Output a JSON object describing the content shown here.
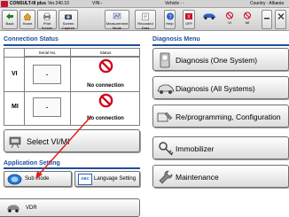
{
  "titlebar": {
    "app_name": "CONSULT-III plus",
    "version": "Ver.240.10",
    "vin": "VIN:-",
    "vehicle": "Vehicle : -",
    "country": "Country : Albania"
  },
  "toolbar": {
    "back": "Back",
    "home": "Home",
    "print_screen": "Print Screen",
    "screen_capture": "Screen Capture",
    "measurement_mode": "Measurement Mode",
    "recorded_data": "Recorded Data",
    "help": "Help",
    "off": "OFF",
    "vi": "VI",
    "mi": "MI"
  },
  "connection_status": {
    "heading": "Connection Status",
    "col_serial": "Serial No.",
    "col_status": "Status",
    "rows": [
      {
        "label": "VI",
        "serial": "-",
        "status": "No connection"
      },
      {
        "label": "MI",
        "serial": "-",
        "status": "No connection"
      }
    ]
  },
  "select_vimi": {
    "label": "Select VI/MI"
  },
  "application_setting": {
    "heading": "Application Setting",
    "sub_mode": "Sub mode",
    "language_setting": "Language Setting",
    "language_icon_text": "ABC",
    "vdr": "VDR"
  },
  "diagnosis_menu": {
    "heading": "Diagnosis Menu",
    "items": [
      {
        "label": "Diagnosis (One System)"
      },
      {
        "label": "Diagnosis (All Systems)"
      },
      {
        "label": "Re/programming, Configuration"
      },
      {
        "label": "Immobilizer"
      },
      {
        "label": "Maintenance"
      }
    ]
  },
  "colors": {
    "heading": "#1f4e9c",
    "no_connection_red": "#d0021b",
    "arrow_red": "#e02020",
    "logo_red": "#c8102e"
  }
}
